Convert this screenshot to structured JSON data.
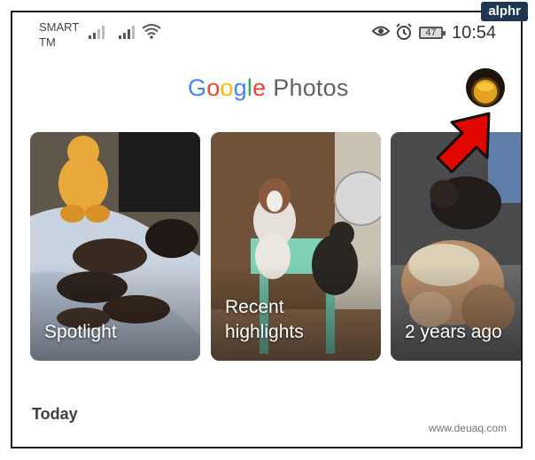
{
  "watermark_brand": "alphr",
  "status_bar": {
    "carrier_line1": "SMART",
    "carrier_line2": "TM",
    "battery": "47",
    "time": "10:54"
  },
  "header": {
    "logo_letters": [
      "G",
      "o",
      "o",
      "g",
      "l",
      "e"
    ],
    "product": "Photos"
  },
  "memories": [
    {
      "label_line1": "Spotlight",
      "label_line2": ""
    },
    {
      "label_line1": "Recent",
      "label_line2": "highlights"
    },
    {
      "label_line1": "2 years ago",
      "label_line2": ""
    }
  ],
  "section": {
    "title": "Today"
  },
  "footer_watermark": "www.deuaq.com",
  "colors": {
    "google_blue": "#4285F4",
    "google_red": "#EA4335",
    "google_yellow": "#FBBC05",
    "google_green": "#34A853",
    "arrow_red": "#e10600"
  }
}
